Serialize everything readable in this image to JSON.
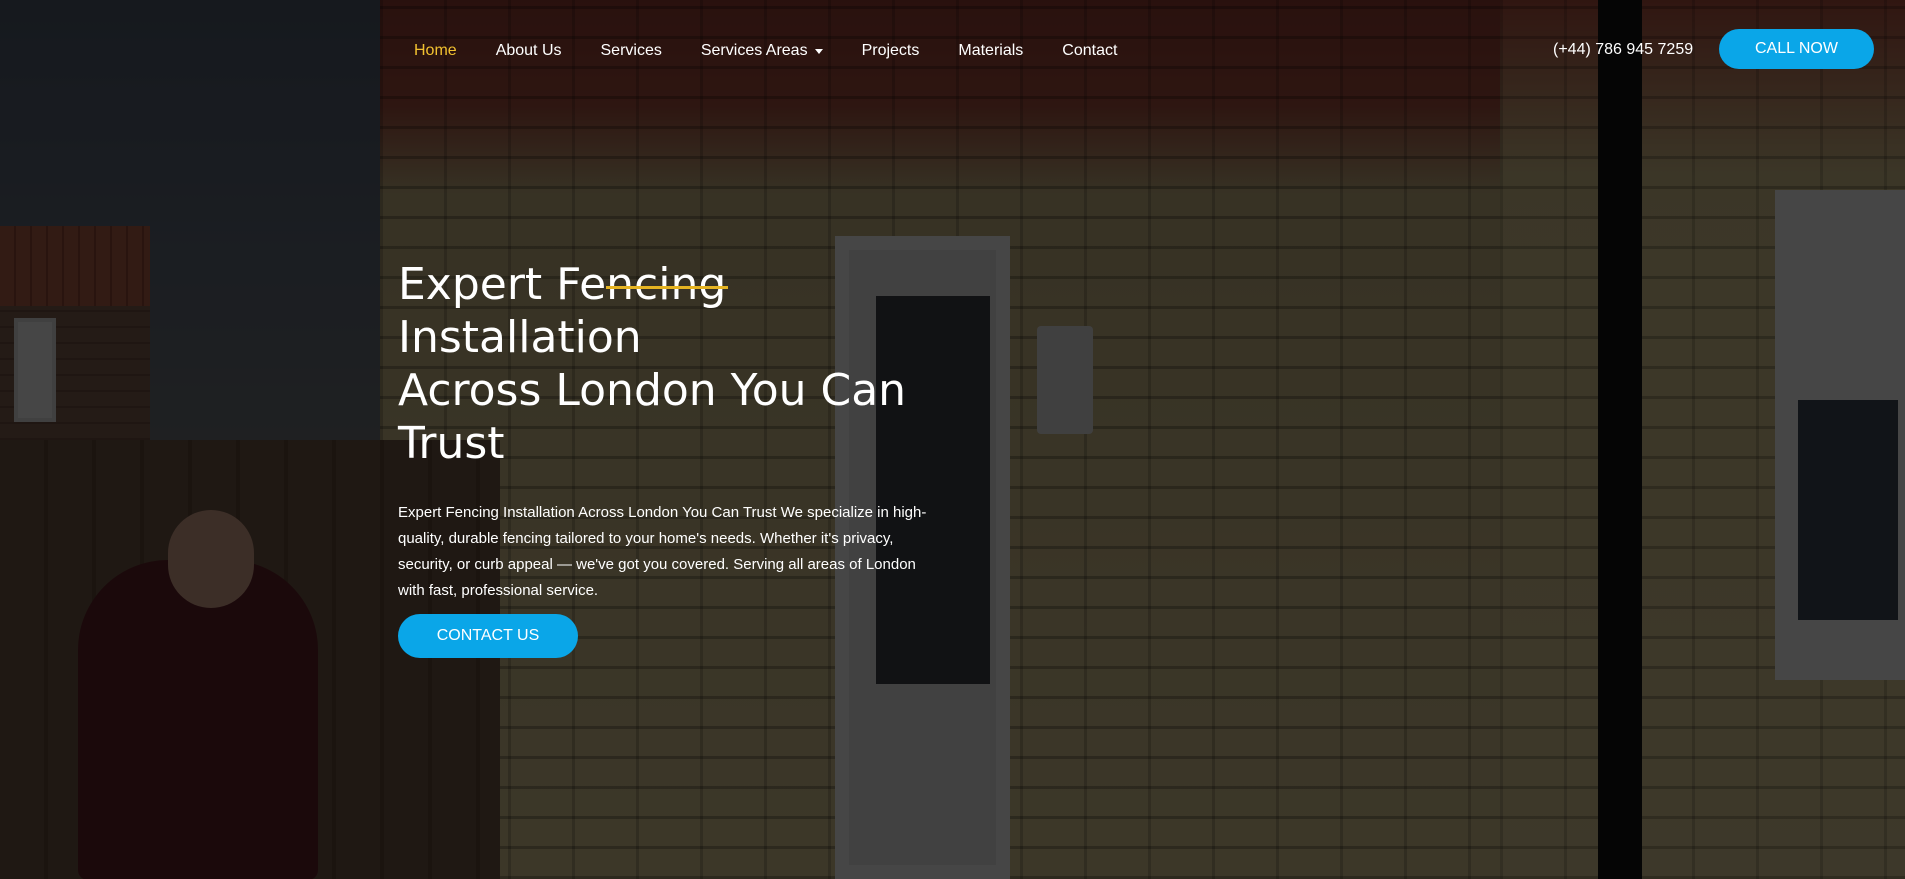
{
  "nav": {
    "items": [
      {
        "label": "Home",
        "active": true
      },
      {
        "label": "About Us"
      },
      {
        "label": "Services"
      },
      {
        "label": "Services Areas",
        "dropdown": true
      },
      {
        "label": "Projects"
      },
      {
        "label": "Materials"
      },
      {
        "label": "Contact"
      }
    ],
    "phone": "(+44) 786 945 7259",
    "cta_label": "CALL NOW"
  },
  "hero": {
    "title_lines": [
      "Expert Fencing",
      "Installation",
      "Across London You Can",
      "Trust"
    ],
    "description": "Expert Fencing Installation Across London You Can Trust We specialize in high-quality, durable fencing tailored to your home's needs. Whether it's privacy, security, or curb appeal — we've got you covered. Serving all areas of London with fast, professional service.",
    "button_label": "CONTACT US"
  },
  "colors": {
    "accent": "#0aa6e8",
    "nav_active": "#f2c230",
    "title_underline": "#e6b422",
    "text": "#ffffff"
  }
}
